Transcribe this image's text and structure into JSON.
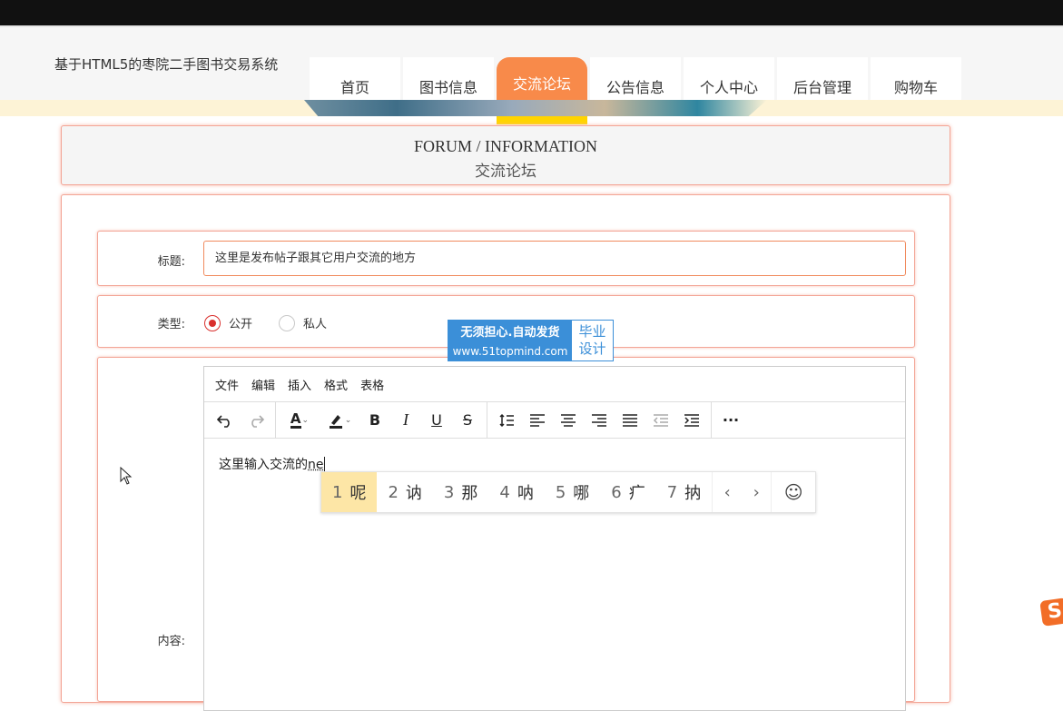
{
  "header": {
    "site_title": "基于HTML5的枣院二手图书交易系统",
    "nav": [
      {
        "label": "首页",
        "active": false
      },
      {
        "label": "图书信息",
        "active": false
      },
      {
        "label": "交流论坛",
        "active": true
      },
      {
        "label": "公告信息",
        "active": false
      },
      {
        "label": "个人中心",
        "active": false
      },
      {
        "label": "后台管理",
        "active": false
      },
      {
        "label": "购物车",
        "active": false
      }
    ]
  },
  "page_title": {
    "en": "FORUM / INFORMATION",
    "zh": "交流论坛"
  },
  "form": {
    "title_label": "标题:",
    "title_value": "这里是发布帖子跟其它用户交流的地方",
    "type_label": "类型:",
    "type_options": [
      {
        "label": "公开",
        "selected": true
      },
      {
        "label": "私人",
        "selected": false
      }
    ],
    "content_label": "内容:"
  },
  "editor": {
    "menu": [
      "文件",
      "编辑",
      "插入",
      "格式",
      "表格"
    ],
    "text": "这里输入交流的",
    "composing": "ne"
  },
  "ime": {
    "candidates": [
      {
        "num": "1",
        "char": "呢"
      },
      {
        "num": "2",
        "char": "讷"
      },
      {
        "num": "3",
        "char": "那"
      },
      {
        "num": "4",
        "char": "呐"
      },
      {
        "num": "5",
        "char": "哪"
      },
      {
        "num": "6",
        "char": "疒"
      },
      {
        "num": "7",
        "char": "抐"
      }
    ]
  },
  "watermark": {
    "line1": "无须担心.自动发货",
    "line2": "www.51topmind.com",
    "right1": "毕业",
    "right2": "设计"
  },
  "colors": {
    "accent": "#f88a4a",
    "accent_bottom": "#ffd400",
    "border": "#f3a596",
    "radio": "#d9302d"
  }
}
